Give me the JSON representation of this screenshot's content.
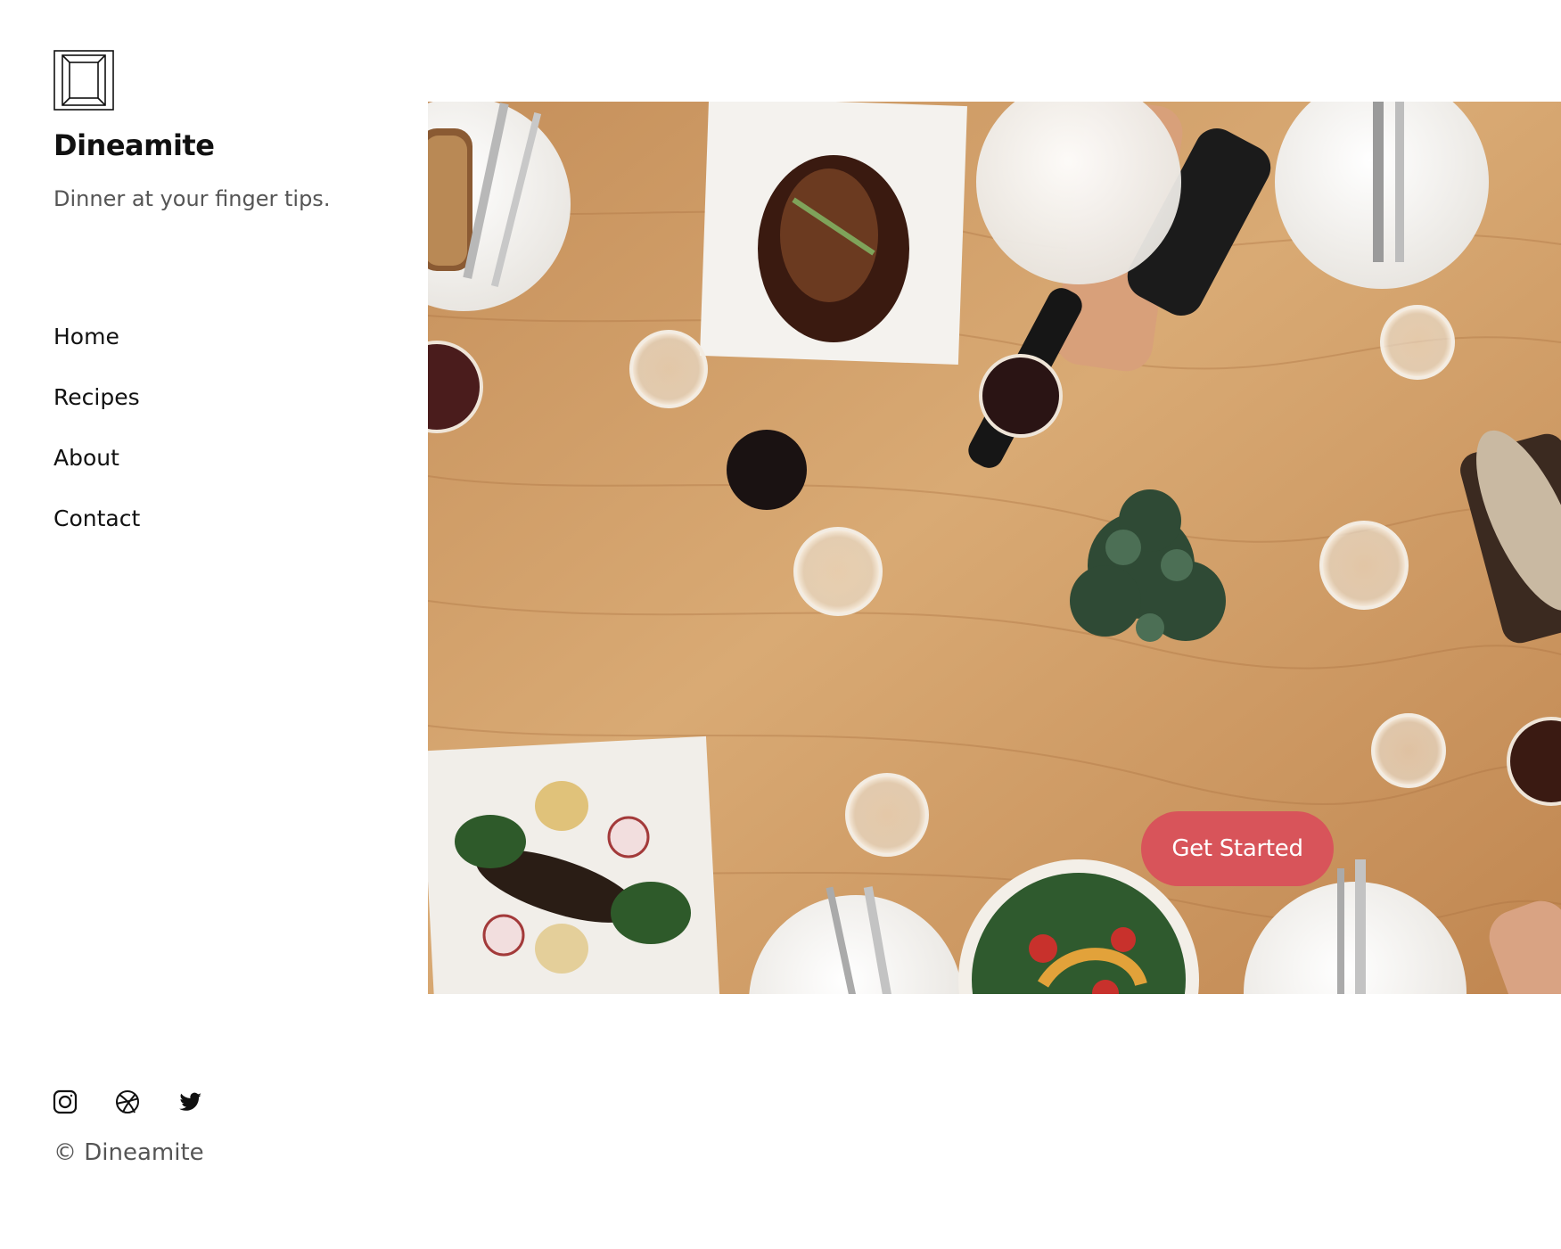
{
  "brand": {
    "name": "Dineamite",
    "tagline": "Dinner at your finger tips."
  },
  "nav": {
    "items": [
      {
        "label": "Home"
      },
      {
        "label": "Recipes"
      },
      {
        "label": "About"
      },
      {
        "label": "Contact"
      }
    ]
  },
  "hero": {
    "image": "overhead-dining-table-photo",
    "cta_label": "Get Started"
  },
  "footer": {
    "social_icons": [
      "instagram-icon",
      "dribbble-icon",
      "twitter-icon"
    ],
    "copyright": "© Dineamite"
  },
  "colors": {
    "accent": "#d8545a",
    "text_primary": "#111111",
    "text_muted": "#555555",
    "background": "#ffffff"
  }
}
